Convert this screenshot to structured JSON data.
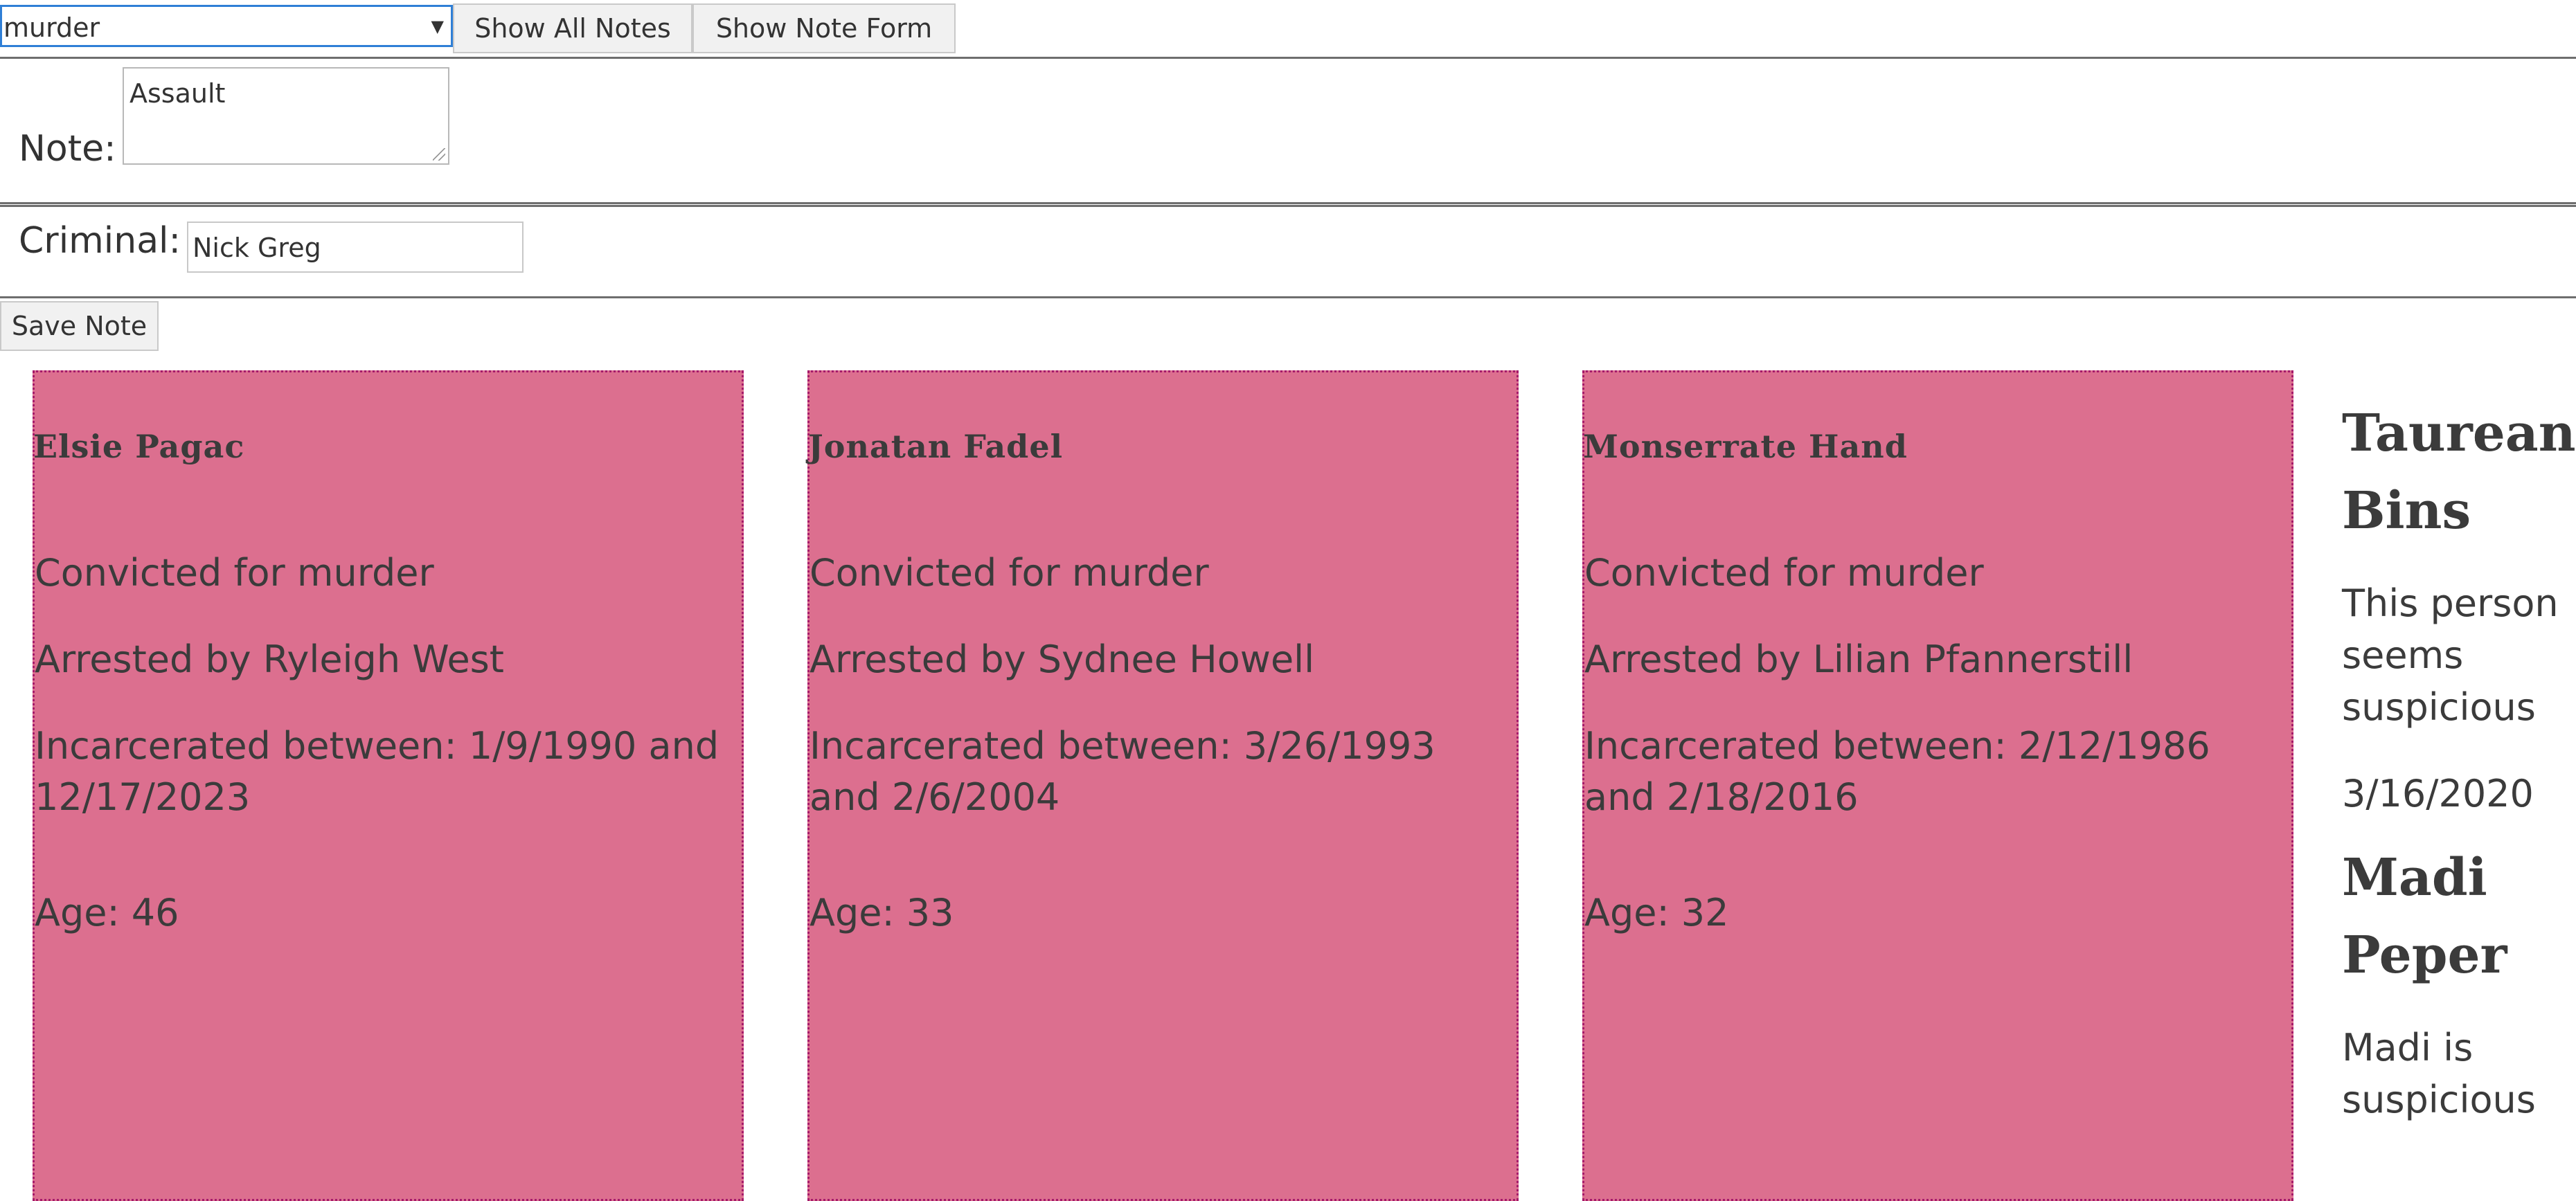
{
  "filter": {
    "selected_crime": "murder",
    "show_all_notes_label": "Show All Notes",
    "show_note_form_label": "Show Note Form"
  },
  "form": {
    "note_label": "Note:",
    "note_value": "Assault",
    "criminal_label": "Criminal:",
    "criminal_value": "Nick Greg",
    "save_label": "Save Note"
  },
  "criminals": [
    {
      "name": "Elsie Pagac",
      "convicted": "Convicted for murder",
      "arrested": "Arrested by Ryleigh West",
      "incarcerated": "Incarcerated between: 1/9/1990 and 12/17/2023",
      "age": "Age: 46"
    },
    {
      "name": "Jonatan Fadel",
      "convicted": "Convicted for murder",
      "arrested": "Arrested by Sydnee Howell",
      "incarcerated": "Incarcerated between: 3/26/1993 and 2/6/2004",
      "age": "Age: 33"
    },
    {
      "name": "Monserrate Hand",
      "convicted": "Convicted for murder",
      "arrested": "Arrested by Lilian Pfannerstill",
      "incarcerated": "Incarcerated between: 2/12/1986 and 2/18/2016",
      "age": "Age: 32"
    }
  ],
  "notes": [
    {
      "criminal": "Taurean Bins",
      "text": "This person seems suspicious",
      "date": "3/16/2020"
    },
    {
      "criminal": "Madi Peper",
      "text": "Madi is suspicious"
    }
  ],
  "colors": {
    "card_background": "#dc6f8f",
    "card_border": "#a51a6a",
    "select_focus": "#2f7fd6"
  }
}
